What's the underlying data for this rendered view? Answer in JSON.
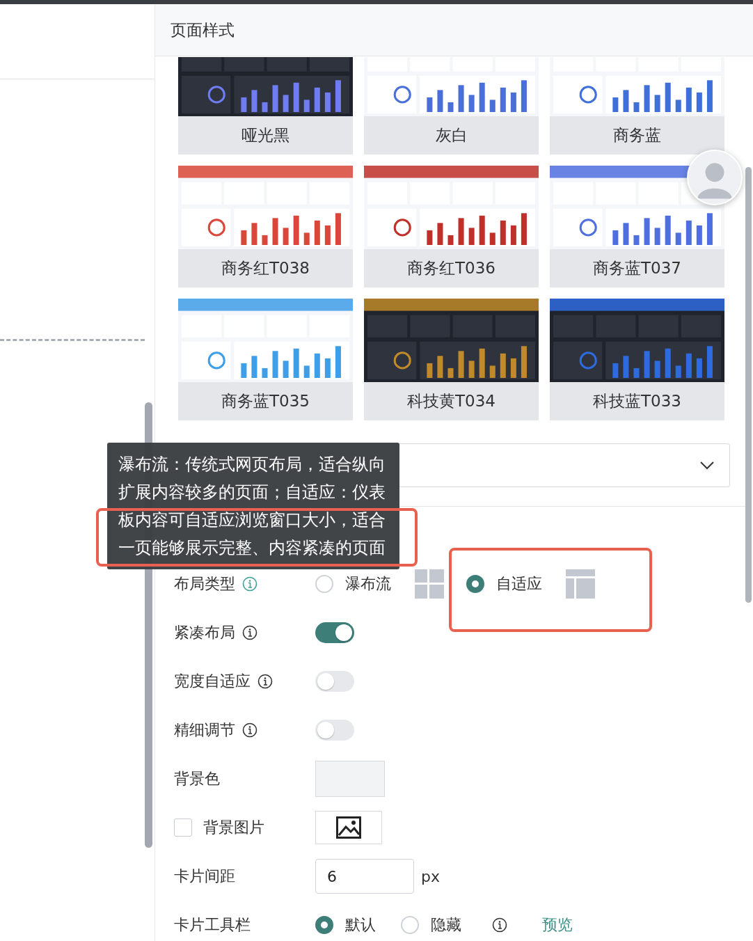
{
  "panel": {
    "title": "页面样式"
  },
  "themes": [
    {
      "label": "哑光黑",
      "kind": "dark",
      "color": "#6f7cf2"
    },
    {
      "label": "灰白",
      "kind": "light",
      "color": "#4a6fd8"
    },
    {
      "label": "商务蓝",
      "kind": "light",
      "color": "#3f6fd8"
    },
    {
      "label": "商务红T038",
      "kind": "light",
      "color": "#d9473a"
    },
    {
      "label": "商务红T036",
      "kind": "light",
      "color": "#c0302a"
    },
    {
      "label": "商务蓝T037",
      "kind": "light",
      "color": "#4f6fe0"
    },
    {
      "label": "商务蓝T035",
      "kind": "light",
      "color": "#3f9ee8"
    },
    {
      "label": "科技黄T034",
      "kind": "dark",
      "color": "#c08a2a"
    },
    {
      "label": "科技蓝T033",
      "kind": "dark",
      "color": "#2f6be0"
    }
  ],
  "tooltip": "瀑布流：传统式网页布局，适合纵向扩展内容较多的页面；自适应：仪表板内容可自适应浏览窗口大小，适合一页能够展示完整、内容紧凑的页面",
  "form": {
    "rows": [
      {
        "kind": "radio",
        "label": "布局类型",
        "info": true,
        "hovered": true,
        "options": [
          {
            "label": "瀑布流",
            "selected": false,
            "info": false
          },
          {
            "label": "自适应",
            "selected": true,
            "info": false
          }
        ]
      },
      {
        "kind": "toggle",
        "label": "紧凑布局",
        "info": true,
        "hovered": false,
        "on": true
      },
      {
        "kind": "toggle",
        "label": "宽度自适应",
        "info": true,
        "hovered": false,
        "on": false
      },
      {
        "kind": "toggle",
        "label": "精细调节",
        "info": true,
        "hovered": false,
        "on": false
      },
      {
        "kind": "color",
        "label": "背景色",
        "info": false,
        "color": "#f2f3f5"
      },
      {
        "kind": "image",
        "label": "背景图片",
        "info": false,
        "checked": false
      },
      {
        "kind": "number",
        "label": "卡片间距",
        "info": false,
        "value": "6",
        "unit": "px"
      },
      {
        "kind": "radio",
        "label": "卡片工具栏",
        "info": false,
        "options": [
          {
            "label": "默认",
            "selected": true,
            "info": false
          },
          {
            "label": "隐藏",
            "selected": false,
            "info": true
          }
        ],
        "link": "预览"
      }
    ]
  }
}
